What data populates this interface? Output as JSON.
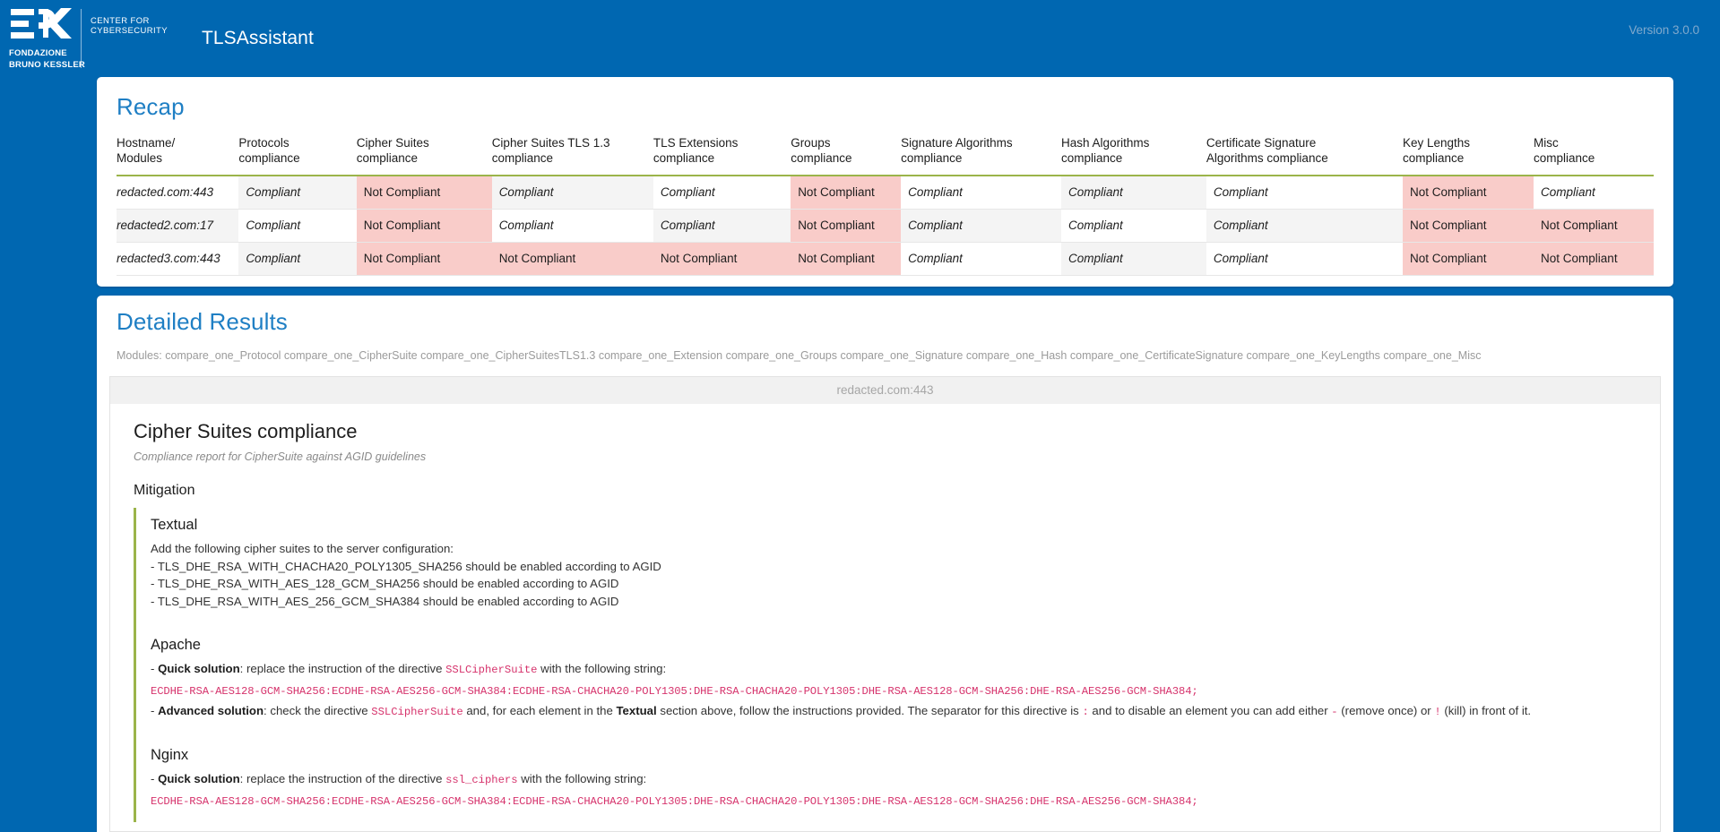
{
  "header": {
    "logo_center_line1": "CENTER FOR",
    "logo_center_line2": "CYBERSECURITY",
    "logo_name_line1": "FONDAZIONE",
    "logo_name_line2": "BRUNO KESSLER",
    "app_title": "TLSAssistant",
    "version": "Version 3.0.0",
    "brand_blue": "#0067b1"
  },
  "recap": {
    "title": "Recap",
    "columns": [
      "Hostname/\nModules",
      "Protocols\ncompliance",
      "Cipher Suites\ncompliance",
      "Cipher Suites TLS 1.3\ncompliance",
      "TLS Extensions\ncompliance",
      "Groups\ncompliance",
      "Signature Algorithms\ncompliance",
      "Hash Algorithms\ncompliance",
      "Certificate Signature\nAlgorithms compliance",
      "Key Lengths\ncompliance",
      "Misc\ncompliance"
    ],
    "compliant_label": "Compliant",
    "not_compliant_label": "Not Compliant",
    "rows": [
      {
        "host": "redacted.com:443",
        "values": [
          "Compliant",
          "Not Compliant",
          "Compliant",
          "Compliant",
          "Not Compliant",
          "Compliant",
          "Compliant",
          "Compliant",
          "Not Compliant",
          "Compliant"
        ]
      },
      {
        "host": "redacted2.com:17",
        "values": [
          "Compliant",
          "Not Compliant",
          "Compliant",
          "Compliant",
          "Not Compliant",
          "Compliant",
          "Compliant",
          "Compliant",
          "Not Compliant",
          "Not Compliant"
        ]
      },
      {
        "host": "redacted3.com:443",
        "values": [
          "Compliant",
          "Not Compliant",
          "Not Compliant",
          "Not Compliant",
          "Not Compliant",
          "Compliant",
          "Compliant",
          "Compliant",
          "Not Compliant",
          "Not Compliant"
        ]
      }
    ],
    "colors": {
      "not_compliant_bg": "#f9ccc9",
      "zebra_bg": "#f4f4f4",
      "header_rule": "#9bb44a"
    }
  },
  "detailed": {
    "title": "Detailed Results",
    "modules_line": "Modules: compare_one_Protocol compare_one_CipherSuite compare_one_CipherSuitesTLS1.3 compare_one_Extension compare_one_Groups compare_one_Signature compare_one_Hash compare_one_CertificateSignature compare_one_KeyLengths compare_one_Misc",
    "host_bar": "redacted.com:443",
    "module": {
      "title": "Cipher Suites compliance",
      "subtitle": "Compliance report for CipherSuite against AGID guidelines",
      "mitigation_label": "Mitigation",
      "textual": {
        "heading": "Textual",
        "intro": "Add the following cipher suites to the server configuration:",
        "items": [
          "- TLS_DHE_RSA_WITH_CHACHA20_POLY1305_SHA256 should be enabled according to AGID",
          "- TLS_DHE_RSA_WITH_AES_128_GCM_SHA256 should be enabled according to AGID",
          "- TLS_DHE_RSA_WITH_AES_256_GCM_SHA384 should be enabled according to AGID"
        ]
      },
      "apache": {
        "heading": "Apache",
        "quick_prefix": "- ",
        "quick_label": "Quick solution",
        "quick_text_1": ": replace the instruction of the directive ",
        "quick_directive": "SSLCipherSuite",
        "quick_text_2": " with the following string:",
        "cipher_string": "ECDHE-RSA-AES128-GCM-SHA256:ECDHE-RSA-AES256-GCM-SHA384:ECDHE-RSA-CHACHA20-POLY1305:DHE-RSA-CHACHA20-POLY1305:DHE-RSA-AES128-GCM-SHA256:DHE-RSA-AES256-GCM-SHA384;",
        "adv_prefix": "- ",
        "adv_label": "Advanced solution",
        "adv_text_1": ": check the directive ",
        "adv_directive": "SSLCipherSuite",
        "adv_text_2": " and, for each element in the ",
        "adv_bold_ref": "Textual",
        "adv_text_3": " section above, follow the instructions provided. The separator for this directive is ",
        "adv_sep": ":",
        "adv_text_4": " and to disable an element you can add either ",
        "adv_minus": "-",
        "adv_text_5": " (remove once) or ",
        "adv_bang": "!",
        "adv_text_6": " (kill) in front of it."
      },
      "nginx": {
        "heading": "Nginx",
        "quick_prefix": "- ",
        "quick_label": "Quick solution",
        "quick_text_1": ": replace the instruction of the directive ",
        "quick_directive": "ssl_ciphers",
        "quick_text_2": " with the following string:",
        "cipher_string": "ECDHE-RSA-AES128-GCM-SHA256:ECDHE-RSA-AES256-GCM-SHA384:ECDHE-RSA-CHACHA20-POLY1305:DHE-RSA-CHACHA20-POLY1305:DHE-RSA-AES128-GCM-SHA256:DHE-RSA-AES256-GCM-SHA384;"
      }
    }
  }
}
